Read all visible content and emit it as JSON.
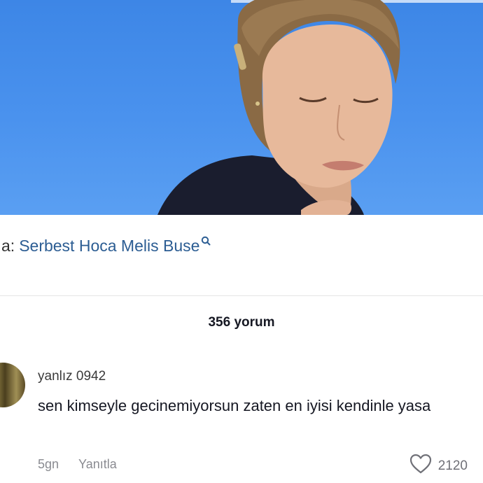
{
  "caption": {
    "prefix": "a:",
    "link_text": "Serbest Hoca Melis Buse",
    "link_icon": "search-icon"
  },
  "comments_header": {
    "count_label": "356 yorum"
  },
  "comment": {
    "username": "yanlız 0942",
    "text": "sen kimseyle gecinemiyorsun zaten en iyisi kendinle yasa",
    "age": "5gn",
    "reply_label": "Yanıtla",
    "like_icon": "heart-icon",
    "like_count": "2120"
  },
  "colors": {
    "sky": "#4a92ee",
    "link": "#2c5d93",
    "meta": "#8a8b91"
  }
}
